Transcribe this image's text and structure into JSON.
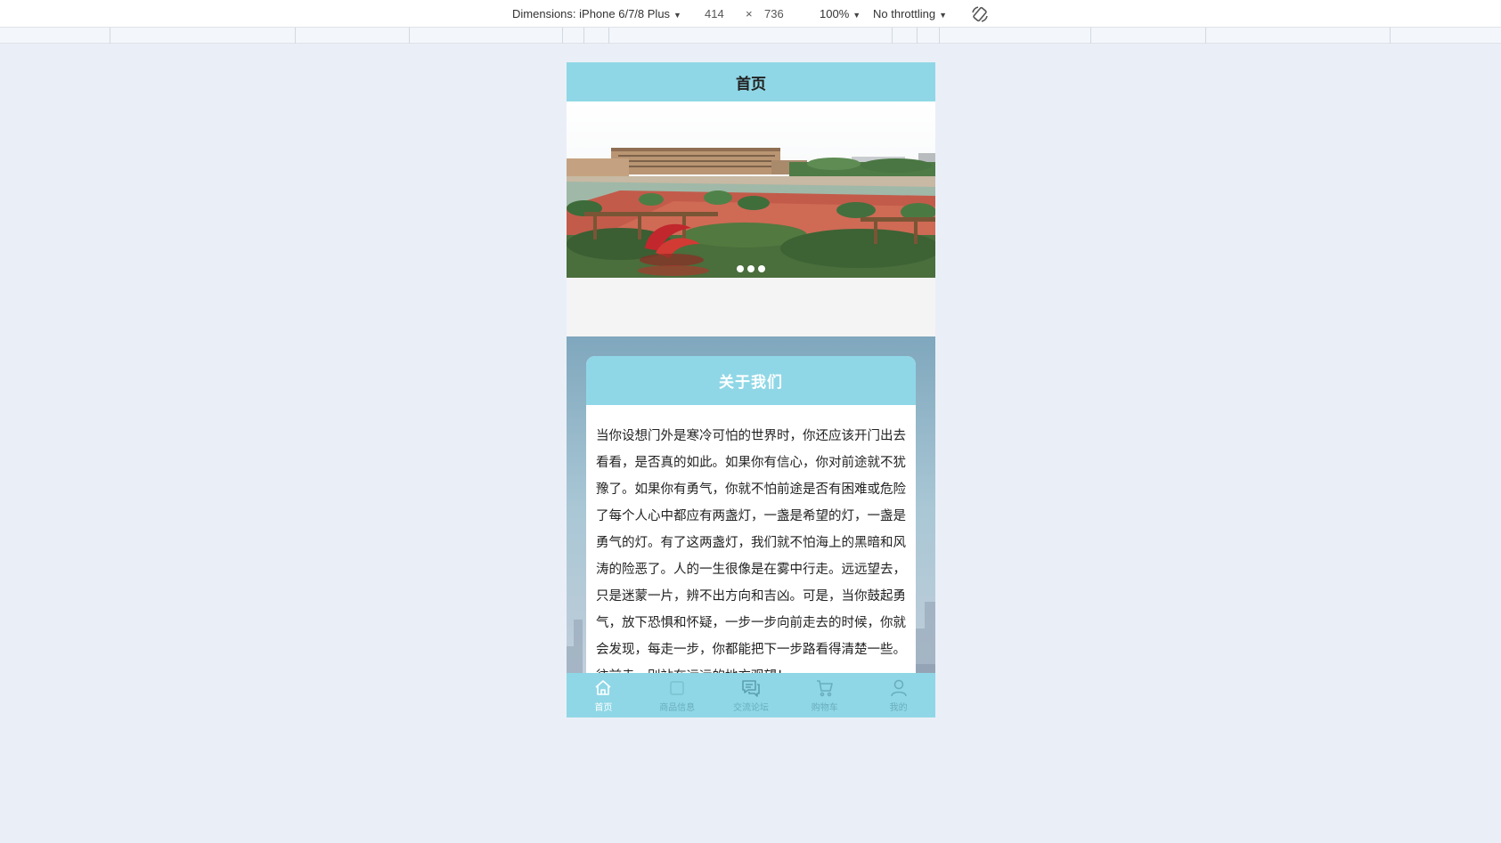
{
  "devtools": {
    "dimensions_label": "Dimensions: iPhone 6/7/8 Plus",
    "width": "414",
    "times": "×",
    "height": "736",
    "zoom": "100%",
    "throttling": "No throttling",
    "caret": "▼",
    "rotate_icon": "rotate-icon"
  },
  "header": {
    "title": "首页"
  },
  "banner": {
    "slides": 3,
    "active_slide": 0
  },
  "about": {
    "title": "关于我们",
    "text": "当你设想门外是寒冷可怕的世界时，你还应该开门出去看看，是否真的如此。如果你有信心，你对前途就不犹豫了。如果你有勇气，你就不怕前途是否有困难或危险了每个人心中都应有两盏灯，一盏是希望的灯，一盏是勇气的灯。有了这两盏灯，我们就不怕海上的黑暗和风涛的险恶了。人的一生很像是在雾中行走。远远望去，只是迷蒙一片，辨不出方向和吉凶。可是，当你鼓起勇气，放下恐惧和怀疑，一步一步向前走去的时候，你就会发现，每走一步，你都能把下一步路看得清楚一些。往前走，别站在远远的地方观望！"
  },
  "tabbar": {
    "items": [
      {
        "label": "首页",
        "icon": "home-icon",
        "active": true
      },
      {
        "label": "商品信息",
        "icon": "goods-icon",
        "active": false
      },
      {
        "label": "交流论坛",
        "icon": "forum-icon",
        "active": false
      },
      {
        "label": "购物车",
        "icon": "cart-icon",
        "active": false
      },
      {
        "label": "我的",
        "icon": "user-icon",
        "active": false
      }
    ]
  },
  "colors": {
    "accent": "#8fd7e6",
    "page_background": "#eaeff7",
    "tab_inactive": "#6aaebe"
  }
}
